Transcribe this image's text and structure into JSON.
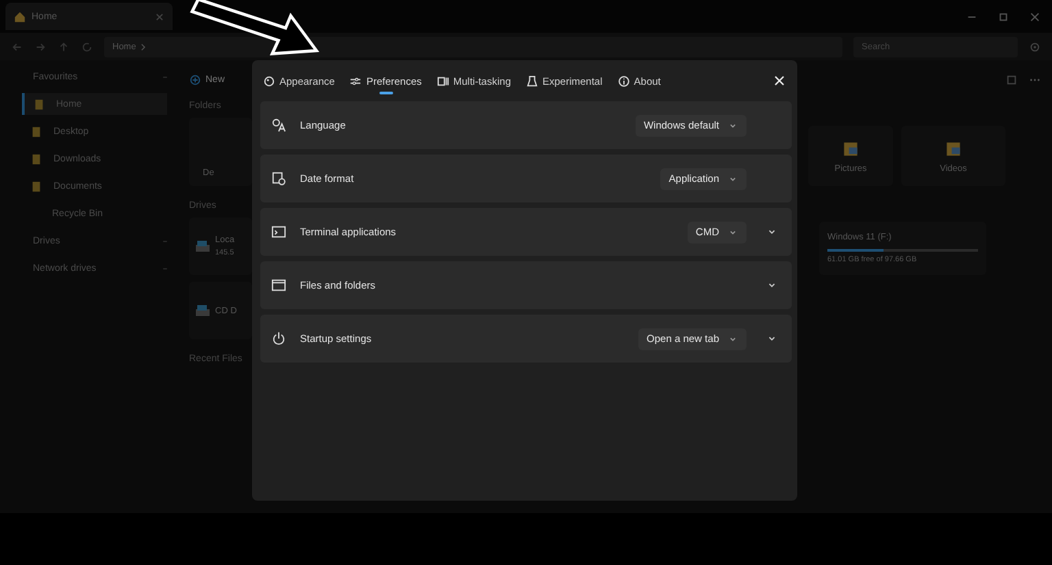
{
  "explorer": {
    "tab": "Home",
    "breadcrumb": "Home",
    "search": {
      "placeholder": "Search"
    },
    "toolbar": [
      "New"
    ],
    "sidebar": [
      {
        "label": "Favourites",
        "kind": "section",
        "selected": false
      },
      {
        "label": "Home",
        "kind": "item",
        "selected": true
      },
      {
        "label": "Desktop",
        "kind": "item",
        "selected": false
      },
      {
        "label": "Downloads",
        "kind": "item",
        "selected": false
      },
      {
        "label": "Documents",
        "kind": "item",
        "selected": false
      },
      {
        "label": "Recycle Bin",
        "kind": "plain",
        "selected": false
      },
      {
        "label": "Drives",
        "kind": "section",
        "selected": false
      },
      {
        "label": "Network drives",
        "kind": "section",
        "selected": false
      }
    ],
    "folders": {
      "title": "Folders",
      "left": [
        "De"
      ],
      "right": [
        "Pictures",
        "Videos"
      ]
    },
    "drives": {
      "title": "Drives",
      "left": [
        {
          "name": "Loca",
          "detail": "145.5"
        },
        {
          "name": "CD D"
        }
      ],
      "right": [
        {
          "name": "Windows 11 (F:)",
          "level": 0.37,
          "detail": "61.01 GB free of 97.66 GB"
        }
      ]
    },
    "recent": {
      "title": "Recent Files"
    }
  },
  "settings": {
    "tabs": [
      {
        "label": "Appearance",
        "selected": false
      },
      {
        "label": "Preferences",
        "selected": true
      },
      {
        "label": "Multi-tasking",
        "selected": false
      },
      {
        "label": "Experimental",
        "selected": false
      },
      {
        "label": "About",
        "selected": false
      }
    ],
    "rows": [
      {
        "label": "Language",
        "value": "Windows default",
        "expandable": false
      },
      {
        "label": "Date format",
        "value": "Application",
        "expandable": false
      },
      {
        "label": "Terminal applications",
        "value": "CMD",
        "expandable": true
      },
      {
        "label": "Files and folders",
        "expandable": true
      },
      {
        "label": "Startup settings",
        "value": "Open a new tab",
        "expandable": true
      }
    ]
  }
}
